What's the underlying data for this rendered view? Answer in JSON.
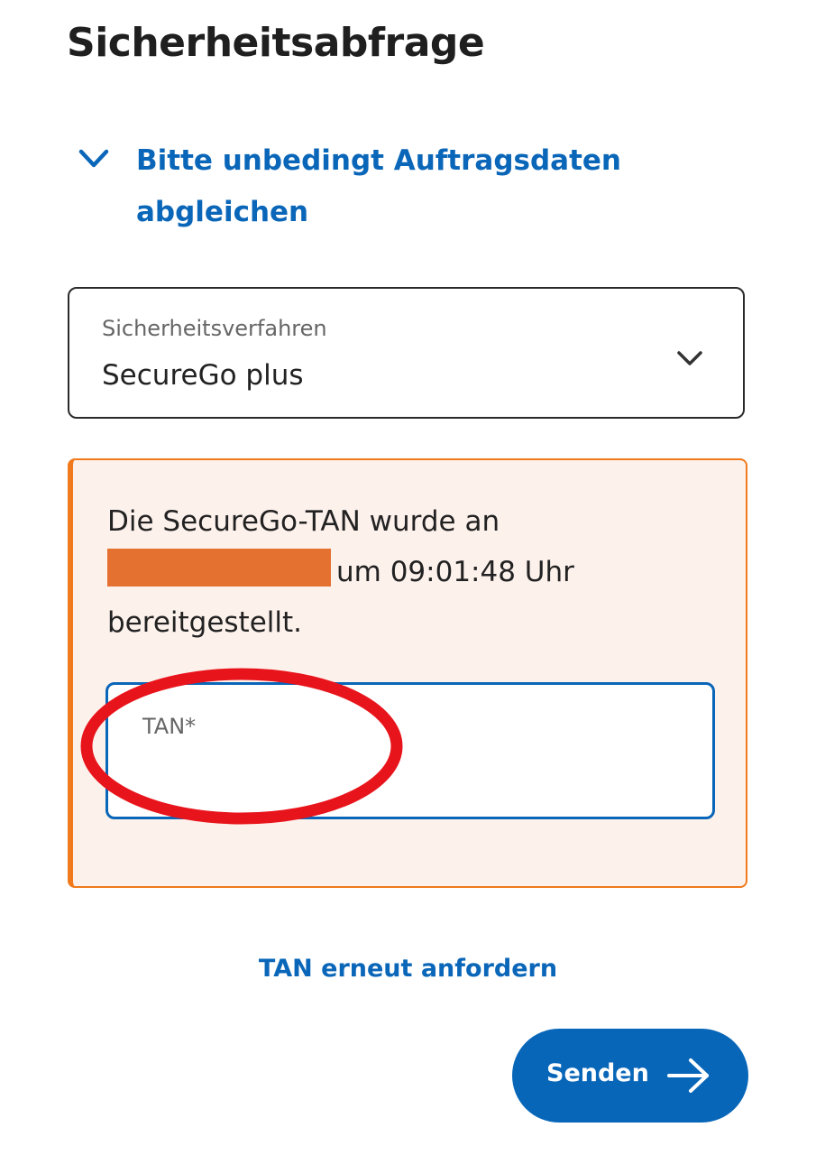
{
  "page": {
    "title": "Sicherheitsabfrage"
  },
  "expander": {
    "text": "Bitte unbedingt Auftragsdaten abgleichen",
    "icon": "chevron-down-icon"
  },
  "security_method": {
    "label": "Sicherheitsverfahren",
    "value": "SecureGo plus",
    "icon": "chevron-down-icon"
  },
  "tan_notice": {
    "text_before": "Die SecureGo-TAN wurde an",
    "text_time": "um 09:01:48 Uhr",
    "text_after": "bereitgestellt."
  },
  "tan_input": {
    "label": "TAN*",
    "value": ""
  },
  "resend_link": "TAN erneut anfordern",
  "send_button": {
    "label": "Senden",
    "icon": "arrow-right-icon"
  },
  "colors": {
    "accent_blue": "#0a66b8",
    "alert_border": "#f07a1c",
    "alert_background": "#fdf1ec",
    "redaction": "#e57131",
    "annotation_red": "#e8141b"
  }
}
